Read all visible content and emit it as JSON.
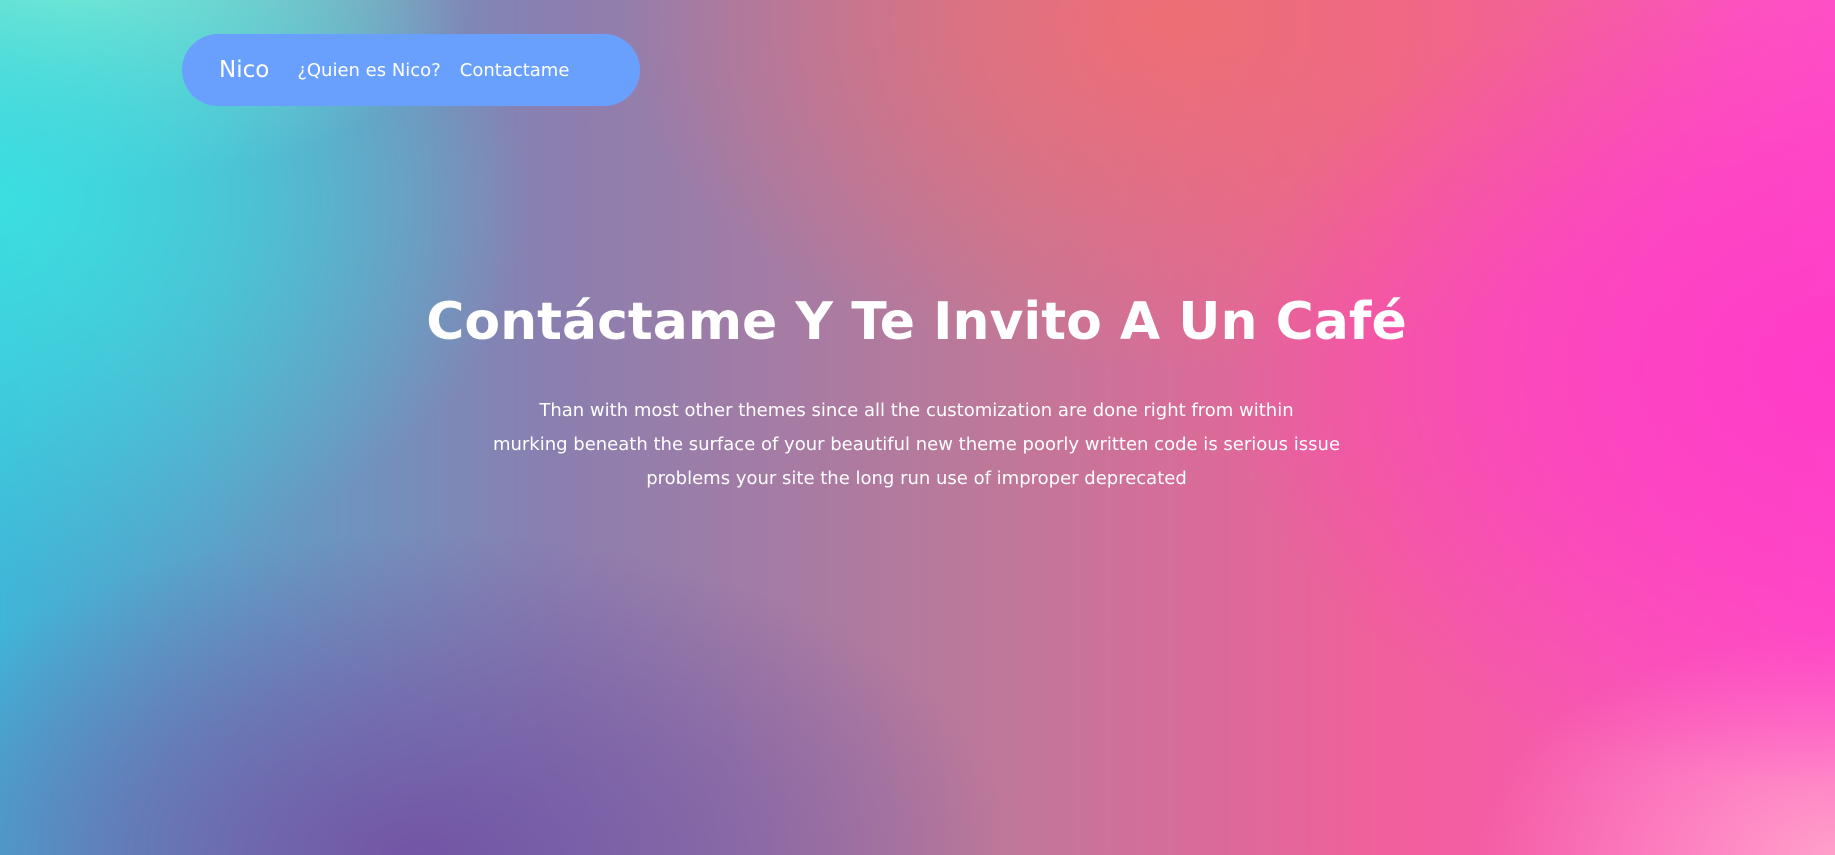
{
  "colors": {
    "navbar_bg": "#6aa0fd",
    "text": "#ffffff",
    "gradient": [
      "#3ce1e1",
      "#a5f0c8",
      "#f06e73",
      "#ff3cc8",
      "#7355a5",
      "#ffa0c8"
    ]
  },
  "navbar": {
    "brand": "Nico",
    "links": [
      {
        "label": "¿Quien es Nico?"
      },
      {
        "label": "Contactame"
      }
    ]
  },
  "hero": {
    "title": "Contáctame Y Te Invito A Un Café",
    "lines": [
      "Than with most other themes since all the customization are done right from within",
      "murking beneath the surface of your beautiful new theme poorly written code is serious issue",
      "problems your site the long run use of improper deprecated"
    ]
  }
}
